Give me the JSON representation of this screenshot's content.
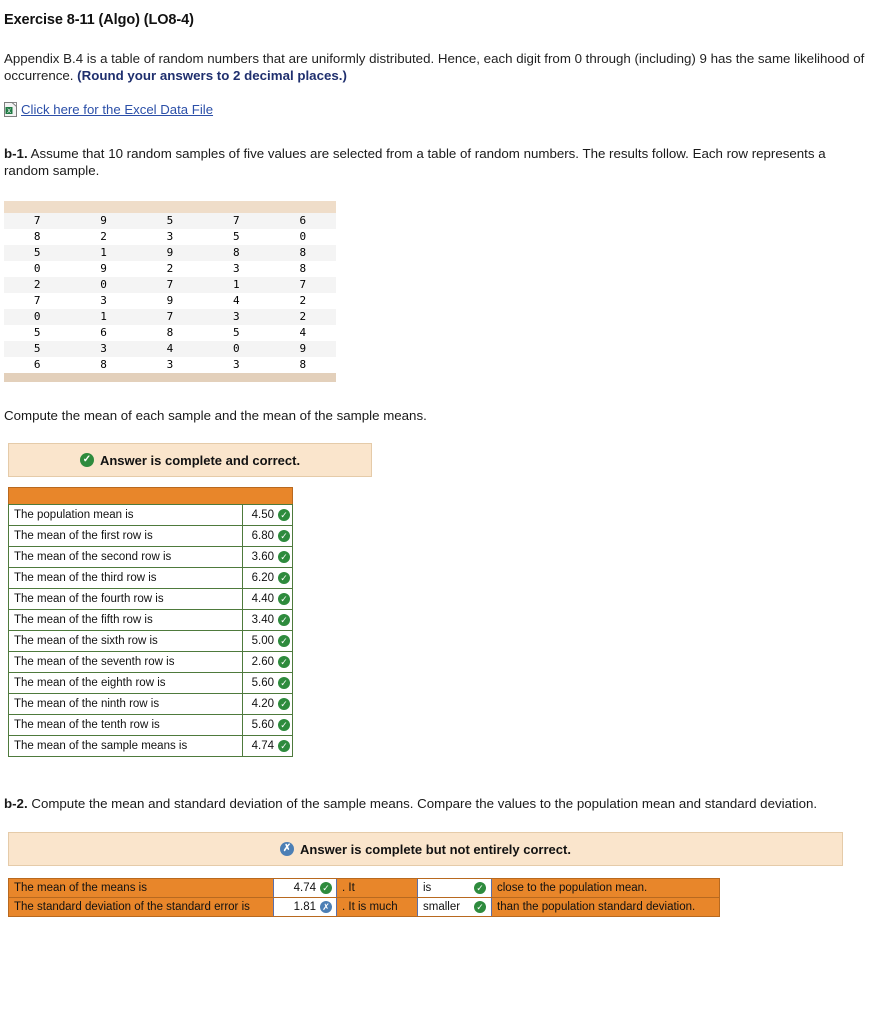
{
  "header": {
    "title": "Exercise 8-11 (Algo) (LO8-4)"
  },
  "intro": {
    "text_part1": "Appendix B.4 is a table of random numbers that are uniformly distributed. Hence, each digit from 0 through (including) 9 has the same likelihood of occurrence. ",
    "rounding_note": "(Round your answers to 2 decimal places.)"
  },
  "excel": {
    "icon": "excel-file-icon",
    "link_text": "Click here for the Excel Data File"
  },
  "b1": {
    "label": "b-1.",
    "text": " Assume that 10 random samples of five values are selected from a table of random numbers. The results follow. Each row represents a random sample.",
    "table": [
      [
        "7",
        "9",
        "5",
        "7",
        "6"
      ],
      [
        "8",
        "2",
        "3",
        "5",
        "0"
      ],
      [
        "5",
        "1",
        "9",
        "8",
        "8"
      ],
      [
        "0",
        "9",
        "2",
        "3",
        "8"
      ],
      [
        "2",
        "0",
        "7",
        "1",
        "7"
      ],
      [
        "7",
        "3",
        "9",
        "4",
        "2"
      ],
      [
        "0",
        "1",
        "7",
        "3",
        "2"
      ],
      [
        "5",
        "6",
        "8",
        "5",
        "4"
      ],
      [
        "5",
        "3",
        "4",
        "0",
        "9"
      ],
      [
        "6",
        "8",
        "3",
        "3",
        "8"
      ]
    ],
    "compute_text": "Compute the mean of each sample and the mean of the sample means.",
    "banner": {
      "icon": "check-circle-icon",
      "text": "Answer is complete and correct."
    },
    "rows": [
      {
        "label": "The population mean is",
        "value": "4.50",
        "status": "correct"
      },
      {
        "label": "The mean of the first row is",
        "value": "6.80",
        "status": "correct"
      },
      {
        "label": "The mean of the second row is",
        "value": "3.60",
        "status": "correct"
      },
      {
        "label": "The mean of the third row is",
        "value": "6.20",
        "status": "correct"
      },
      {
        "label": "The mean of the fourth row is",
        "value": "4.40",
        "status": "correct"
      },
      {
        "label": "The mean of the fifth row is",
        "value": "3.40",
        "status": "correct"
      },
      {
        "label": "The mean of the sixth row is",
        "value": "5.00",
        "status": "correct"
      },
      {
        "label": "The mean of the seventh row is",
        "value": "2.60",
        "status": "correct"
      },
      {
        "label": "The mean of the eighth row is",
        "value": "5.60",
        "status": "correct"
      },
      {
        "label": "The mean of the ninth row is",
        "value": "4.20",
        "status": "correct"
      },
      {
        "label": "The mean of the tenth row is",
        "value": "5.60",
        "status": "correct"
      },
      {
        "label": "The mean of the sample means is",
        "value": "4.74",
        "status": "correct"
      }
    ]
  },
  "b2": {
    "label": "b-2.",
    "text": " Compute the mean and standard deviation of the sample means. Compare the values to the population mean and standard deviation.",
    "banner": {
      "icon": "x-circle-icon",
      "text": "Answer is complete but not entirely correct."
    },
    "rows": [
      {
        "label": "The mean of the means is",
        "value": "4.74",
        "status": "correct",
        "mid": ". It",
        "select": "is",
        "select_status": "correct",
        "tail": "close to the population mean."
      },
      {
        "label": "The standard deviation of the standard error is",
        "value": "1.81",
        "status": "incorrect",
        "mid": ". It is much",
        "select": "smaller",
        "select_status": "correct",
        "tail": "than the population standard deviation."
      }
    ]
  }
}
